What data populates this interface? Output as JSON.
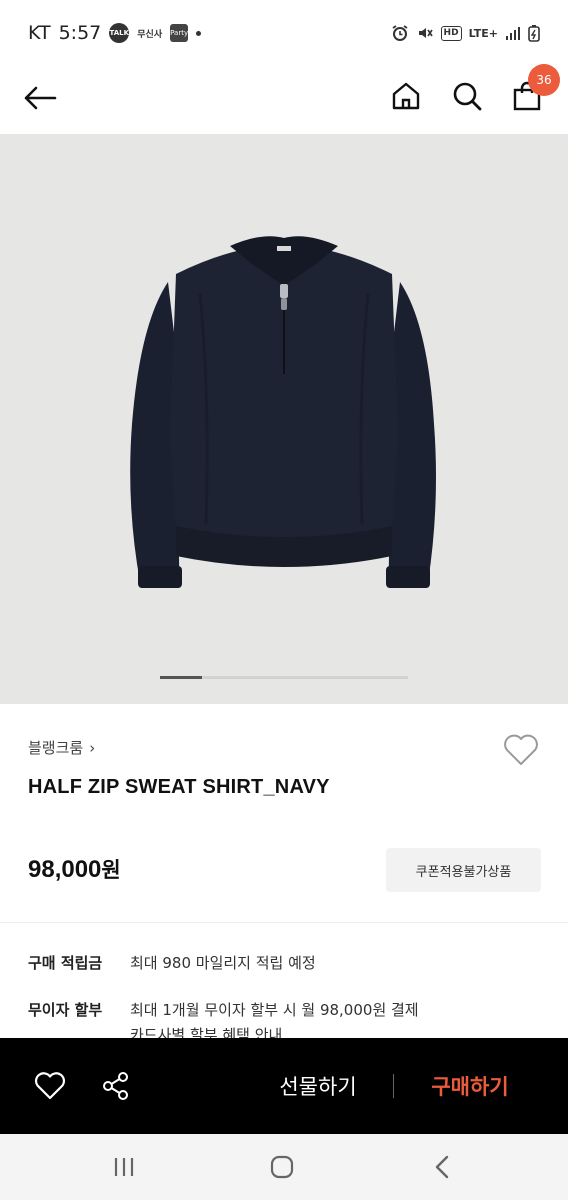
{
  "status_bar": {
    "carrier": "KT",
    "time": "5:57",
    "notif_icons": [
      "talk-icon",
      "app-notification-icon",
      "app-notification-icon",
      "dot-icon"
    ],
    "talk_label": "TALK",
    "app_label_1": "무신사",
    "app_label_2": "Party",
    "hd_label": "HD",
    "network_label": "LTE+"
  },
  "header": {
    "cart_count": "36"
  },
  "gallery": {
    "current_index": 1,
    "total": 6
  },
  "product": {
    "brand": "블랭크룸",
    "brand_chevron": "›",
    "name": "HALF ZIP SWEAT SHIRT_NAVY",
    "price_number": "98,000",
    "price_unit": "원",
    "coupon_label": "쿠폰적용불가상품"
  },
  "info": {
    "points_label": "구매 적립금",
    "points_value": "최대 980 마일리지 적립 예정",
    "installment_label": "무이자 할부",
    "installment_value": "최대 1개월 무이자 할부 시 월 98,000원 결제",
    "installment_sub": "카드사별 할부 혜택 안내"
  },
  "actions": {
    "gift_label": "선물하기",
    "buy_label": "구매하기"
  },
  "colors": {
    "accent": "#ec5b3c",
    "action_bar": "#000000",
    "hero_bg": "#e6e6e4",
    "garment": "#1c2130"
  }
}
